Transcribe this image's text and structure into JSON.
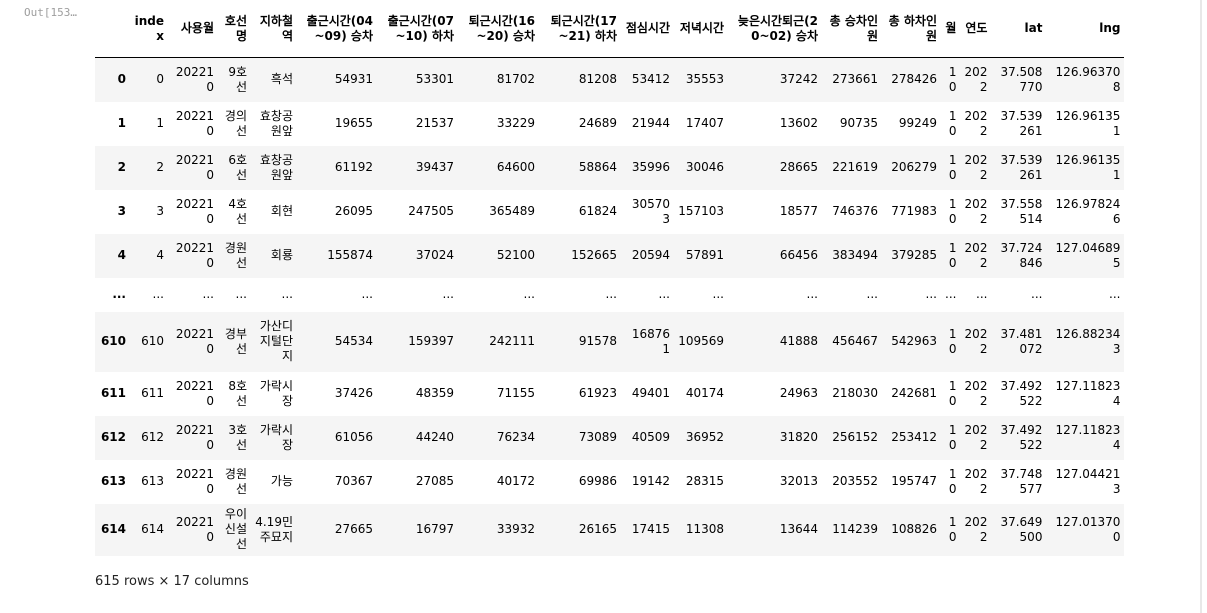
{
  "prompt_label": "Out[153…",
  "columns": [
    "",
    "index",
    "사용월",
    "호선명",
    "지하철역",
    "출근시간(04~09) 승차",
    "출근시간(07~10) 하차",
    "퇴근시간(16~20) 승차",
    "퇴근시간(17~21) 하차",
    "점심시간",
    "저녁시간",
    "늦은시간퇴근(20~02) 승차",
    "총 승차인원",
    "총 하차인원",
    "월",
    "연도",
    "lat",
    "lng"
  ],
  "rows": [
    [
      "0",
      "0",
      "202210",
      "9호선",
      "흑석",
      "54931",
      "53301",
      "81702",
      "81208",
      "53412",
      "35553",
      "37242",
      "273661",
      "278426",
      "10",
      "2022",
      "37.508770",
      "126.963708"
    ],
    [
      "1",
      "1",
      "202210",
      "경의선",
      "효창공원앞",
      "19655",
      "21537",
      "33229",
      "24689",
      "21944",
      "17407",
      "13602",
      "90735",
      "99249",
      "10",
      "2022",
      "37.539261",
      "126.961351"
    ],
    [
      "2",
      "2",
      "202210",
      "6호선",
      "효창공원앞",
      "61192",
      "39437",
      "64600",
      "58864",
      "35996",
      "30046",
      "28665",
      "221619",
      "206279",
      "10",
      "2022",
      "37.539261",
      "126.961351"
    ],
    [
      "3",
      "3",
      "202210",
      "4호선",
      "회현",
      "26095",
      "247505",
      "365489",
      "61824",
      "305703",
      "157103",
      "18577",
      "746376",
      "771983",
      "10",
      "2022",
      "37.558514",
      "126.978246"
    ],
    [
      "4",
      "4",
      "202210",
      "경원선",
      "회룡",
      "155874",
      "37024",
      "52100",
      "152665",
      "20594",
      "57891",
      "66456",
      "383494",
      "379285",
      "10",
      "2022",
      "37.724846",
      "127.046895"
    ],
    [
      "...",
      "...",
      "...",
      "...",
      "...",
      "...",
      "...",
      "...",
      "...",
      "...",
      "...",
      "...",
      "...",
      "...",
      "...",
      "...",
      "...",
      "..."
    ],
    [
      "610",
      "610",
      "202210",
      "경부선",
      "가산디지털단지",
      "54534",
      "159397",
      "242111",
      "91578",
      "168761",
      "109569",
      "41888",
      "456467",
      "542963",
      "10",
      "2022",
      "37.481072",
      "126.882343"
    ],
    [
      "611",
      "611",
      "202210",
      "8호선",
      "가락시장",
      "37426",
      "48359",
      "71155",
      "61923",
      "49401",
      "40174",
      "24963",
      "218030",
      "242681",
      "10",
      "2022",
      "37.492522",
      "127.118234"
    ],
    [
      "612",
      "612",
      "202210",
      "3호선",
      "가락시장",
      "61056",
      "44240",
      "76234",
      "73089",
      "40509",
      "36952",
      "31820",
      "256152",
      "253412",
      "10",
      "2022",
      "37.492522",
      "127.118234"
    ],
    [
      "613",
      "613",
      "202210",
      "경원선",
      "가능",
      "70367",
      "27085",
      "40172",
      "69986",
      "19142",
      "28315",
      "32013",
      "203552",
      "195747",
      "10",
      "2022",
      "37.748577",
      "127.044213"
    ],
    [
      "614",
      "614",
      "202210",
      "우이신설선",
      "4.19민주묘지",
      "27665",
      "16797",
      "33932",
      "26165",
      "17415",
      "11308",
      "13644",
      "114239",
      "108826",
      "10",
      "2022",
      "37.649500",
      "127.013700"
    ]
  ],
  "footer": "615 rows × 17 columns"
}
